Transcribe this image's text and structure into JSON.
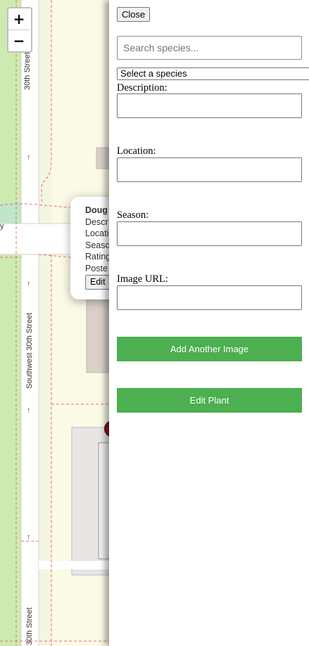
{
  "map": {
    "zoom_in_label": "+",
    "zoom_out_label": "−",
    "street_labels": [
      "30th Street",
      "Southwest 30th Street",
      "30th Street",
      "y"
    ],
    "oneway_glyph": "↑",
    "popup": {
      "title": "Doug",
      "lines": [
        "Descr",
        "Locati",
        "Seaso",
        "Rating",
        "Poste"
      ],
      "edit_label": "Edit"
    }
  },
  "panel": {
    "close_label": "Close",
    "search_placeholder": "Search species...",
    "species_select_value": "Select a species",
    "description_label": "Description:",
    "location_label": "Location:",
    "season_label": "Season:",
    "image_url_label": "Image URL:",
    "add_image_label": "Add Another Image",
    "edit_plant_label": "Edit Plant"
  },
  "colors": {
    "button_green": "#4caf50",
    "map_background": "#fbfae6",
    "park_green": "#cdebb0",
    "marker": "#7a1a1a"
  }
}
